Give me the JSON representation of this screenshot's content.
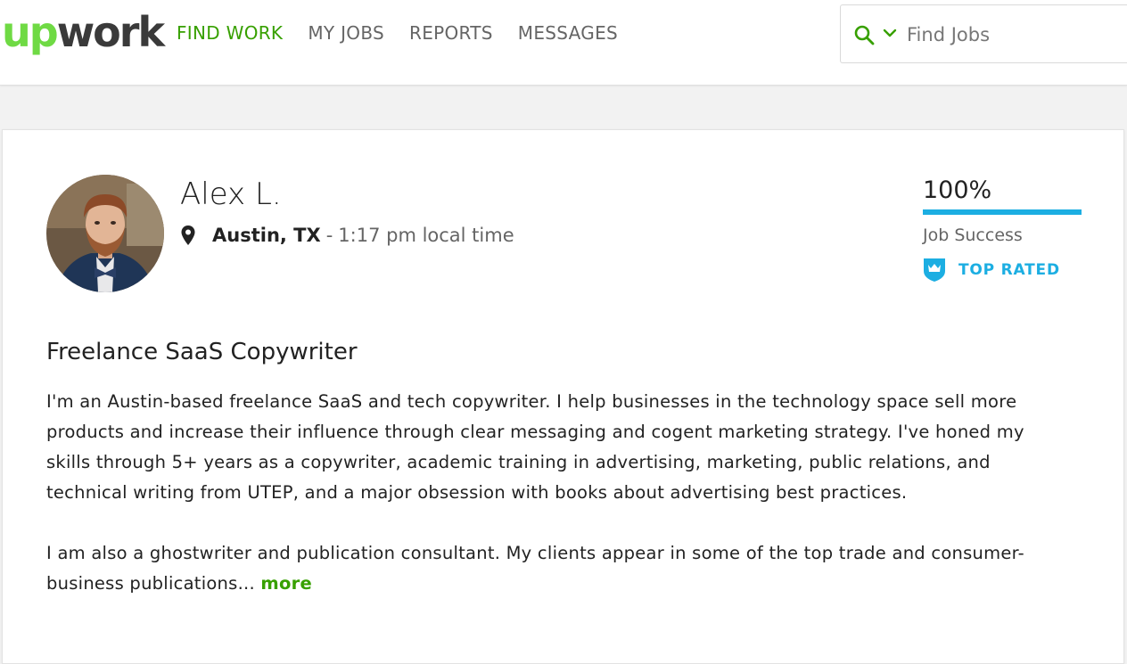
{
  "brand": {
    "logo_up": "up",
    "logo_work": "work",
    "accent": "#6fda44",
    "nav_active": "#37a000",
    "info": "#1caee2"
  },
  "nav": {
    "items": [
      "FIND WORK",
      "MY JOBS",
      "REPORTS",
      "MESSAGES"
    ]
  },
  "search": {
    "placeholder": "Find Jobs",
    "icon": "search-icon",
    "dropdown_icon": "chevron-down-icon"
  },
  "profile": {
    "name": "Alex L.",
    "location": "Austin, TX",
    "separator": "-",
    "local_time": "1:17 pm local time",
    "job_success": {
      "value_text": "100%",
      "value": 1.0,
      "label": "Job Success"
    },
    "badge": "TOP RATED",
    "headline": "Freelance SaaS Copywriter",
    "description": [
      "I'm an Austin-based freelance SaaS and tech copywriter. I help businesses in the technology space sell more products and increase their influence through clear messaging and cogent marketing strategy. I've honed my skills through 5+ years as a copywriter, academic training in advertising, marketing, public relations, and technical writing from UTEP, and a major obsession with books about advertising best practices.",
      "I am also a ghostwriter and publication consultant. My clients appear in some of the top trade and consumer-business publications..."
    ],
    "more_link": "more"
  }
}
